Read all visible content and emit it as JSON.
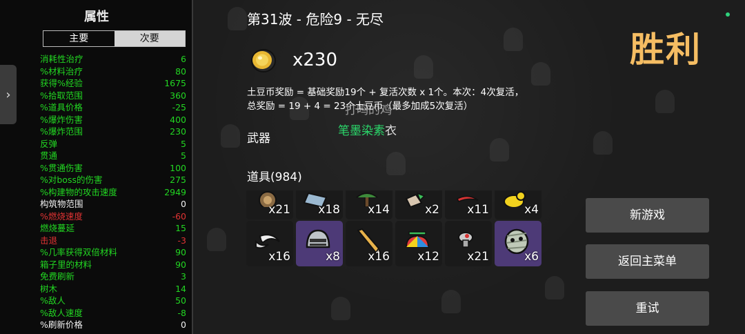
{
  "stats_panel": {
    "title": "属性",
    "tabs": [
      {
        "label": "主要",
        "active": true
      },
      {
        "label": "次要",
        "active": false
      }
    ],
    "rows": [
      {
        "label": "消耗性治疗",
        "value": "6",
        "color": "green"
      },
      {
        "label": "%材料治疗",
        "value": "80",
        "color": "green"
      },
      {
        "label": "获得%经验",
        "value": "1675",
        "color": "green"
      },
      {
        "label": "%拾取范围",
        "value": "360",
        "color": "green"
      },
      {
        "label": "%道具价格",
        "value": "-25",
        "color": "green"
      },
      {
        "label": "%爆炸伤害",
        "value": "400",
        "color": "green"
      },
      {
        "label": "%爆炸范围",
        "value": "230",
        "color": "green"
      },
      {
        "label": "反弹",
        "value": "5",
        "color": "green"
      },
      {
        "label": "贯通",
        "value": "5",
        "color": "green"
      },
      {
        "label": "%贯通伤害",
        "value": "100",
        "color": "green"
      },
      {
        "label": "%对boss的伤害",
        "value": "275",
        "color": "green"
      },
      {
        "label": "%构建物的攻击速度",
        "value": "2949",
        "color": "green"
      },
      {
        "label": "构筑物范围",
        "value": "0",
        "color": "white"
      },
      {
        "label": "%燃烧速度",
        "value": "-60",
        "color": "red"
      },
      {
        "label": "燃烧蔓延",
        "value": "15",
        "color": "green"
      },
      {
        "label": "击退",
        "value": "-3",
        "color": "red"
      },
      {
        "label": "%几率获得双倍材料",
        "value": "90",
        "color": "green"
      },
      {
        "label": "箱子里的材料",
        "value": "90",
        "color": "green"
      },
      {
        "label": "免费刷新",
        "value": "3",
        "color": "green"
      },
      {
        "label": "树木",
        "value": "14",
        "color": "green"
      },
      {
        "label": "%敌人",
        "value": "50",
        "color": "green"
      },
      {
        "label": "%敌人速度",
        "value": "-8",
        "color": "green"
      },
      {
        "label": "%刷新价格",
        "value": "0",
        "color": "white"
      }
    ]
  },
  "center": {
    "wave_title": "第31波 - 危险9 - 无尽",
    "coin_amount": "x230",
    "reward_line1": "土豆币奖励 = 基础奖励19个 + 复活次数 x 1个。本次：4次复活，",
    "reward_line2": "总奖励 = 19 + 4 = 23个土豆币（最多加成5次复活）",
    "overlay_name": "打鸣的鸡",
    "item_name_green": "笔墨染素",
    "item_name_white": "衣",
    "weapons_label": "武器",
    "items_label": "道具(984)",
    "items_row1": [
      {
        "count": "x21",
        "rarity": "common",
        "icon": "target-icon"
      },
      {
        "count": "x18",
        "rarity": "common",
        "icon": "book-icon"
      },
      {
        "count": "x14",
        "rarity": "common",
        "icon": "tree-icon"
      },
      {
        "count": "x2",
        "rarity": "common",
        "icon": "claw-icon"
      },
      {
        "count": "x11",
        "rarity": "common",
        "icon": "red-blade-icon"
      },
      {
        "count": "x4",
        "rarity": "common",
        "icon": "duck-icon"
      }
    ],
    "items_row2": [
      {
        "count": "x16",
        "rarity": "common",
        "icon": "crescent-icon"
      },
      {
        "count": "x8",
        "rarity": "legendary",
        "icon": "helmet-icon"
      },
      {
        "count": "x16",
        "rarity": "common",
        "icon": "pencil-icon"
      },
      {
        "count": "x12",
        "rarity": "common",
        "icon": "propeller-hat-icon"
      },
      {
        "count": "x21",
        "rarity": "common",
        "icon": "mushroom-icon"
      },
      {
        "count": "x6",
        "rarity": "legendary",
        "icon": "mummy-icon"
      }
    ]
  },
  "right": {
    "victory_title": "胜利",
    "buttons": {
      "new_game": "新游戏",
      "main_menu": "返回主菜单",
      "retry": "重试"
    }
  },
  "colors": {
    "victory": "#f5bd63",
    "stat_green": "#22d622",
    "stat_red": "#e03333",
    "legendary_slot": "#4d3a77",
    "button_bg": "#4a4a4a"
  }
}
